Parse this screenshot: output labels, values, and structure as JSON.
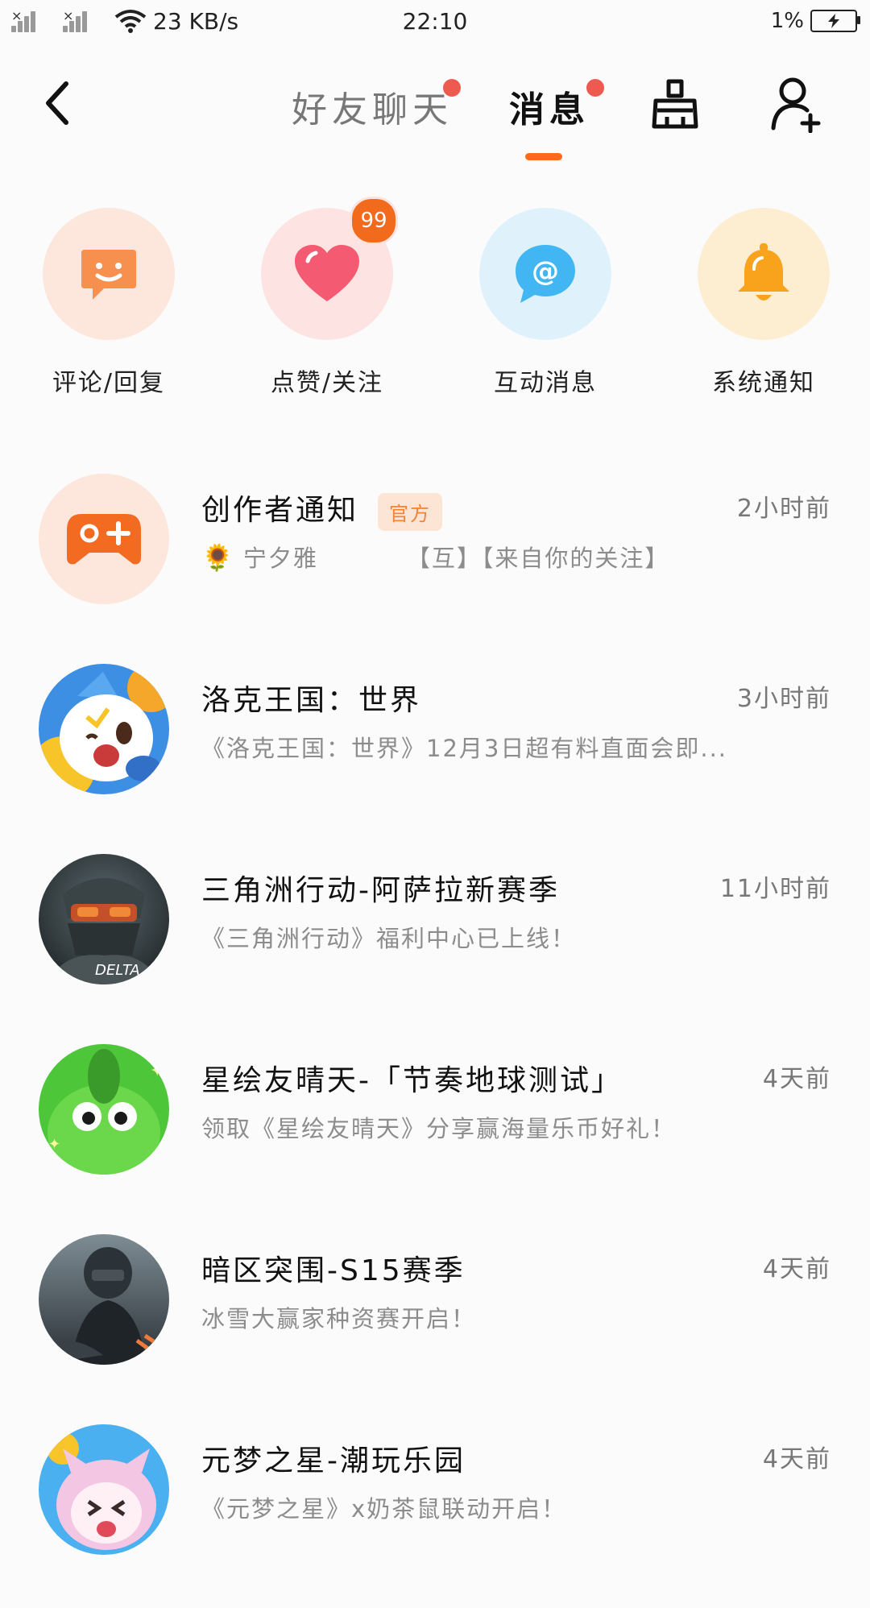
{
  "status": {
    "network_speed": "23 KB/s",
    "time": "22:10",
    "battery": "1%"
  },
  "header": {
    "tab_friends": "好友聊天",
    "tab_messages": "消息"
  },
  "quick": [
    {
      "label": "评论/回复",
      "icon": "smile-chat-icon",
      "color": "#f7904f"
    },
    {
      "label": "点赞/关注",
      "icon": "heart-icon",
      "color": "#f45b72",
      "badge": "99"
    },
    {
      "label": "互动消息",
      "icon": "at-chat-icon",
      "color": "#41b6f2"
    },
    {
      "label": "系统通知",
      "icon": "bell-icon",
      "color": "#f9a21c"
    }
  ],
  "list": [
    {
      "title": "创作者通知",
      "tag": "官方",
      "time": "2小时前",
      "sub_prefix": "宁夕雅",
      "sub": "【互】【来自你的关注】",
      "icon": "gamepad-icon"
    },
    {
      "title": "洛克王国：世界",
      "time": "3小时前",
      "sub": "《洛克王国：世界》12月3日超有料直面会即..."
    },
    {
      "title": "三角洲行动-阿萨拉新赛季",
      "time": "11小时前",
      "sub": "《三角洲行动》福利中心已上线！"
    },
    {
      "title": "星绘友晴天-「节奏地球测试」",
      "time": "4天前",
      "sub": "领取《星绘友晴天》分享赢海量乐币好礼！"
    },
    {
      "title": "暗区突围-S15赛季",
      "time": "4天前",
      "sub": "冰雪大赢家种资赛开启！"
    },
    {
      "title": "元梦之星-潮玩乐园",
      "time": "4天前",
      "sub": "《元梦之星》x奶茶鼠联动开启！"
    }
  ],
  "colors": {
    "accent": "#ff6a1a",
    "red_dot": "#ef5a50"
  }
}
